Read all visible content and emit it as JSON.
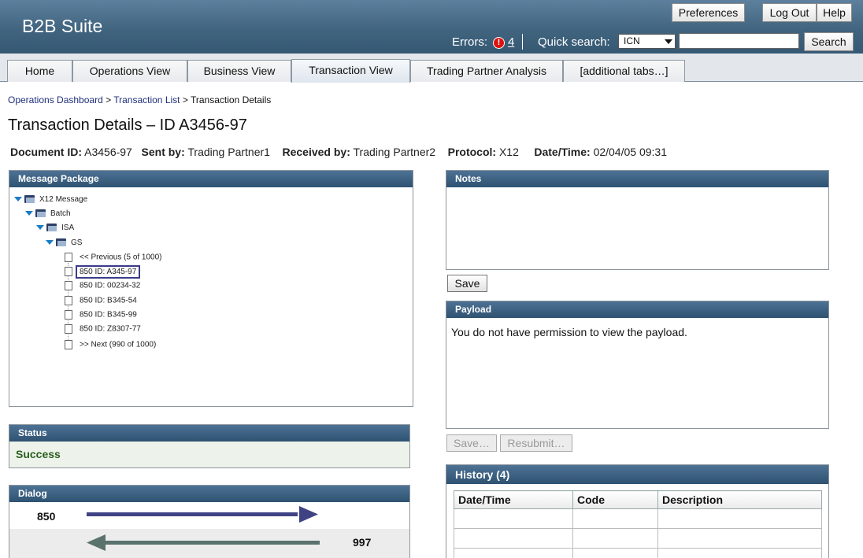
{
  "header": {
    "title": "B2B Suite",
    "preferences_label": "Preferences",
    "logout_label": "Log Out",
    "help_label": "Help",
    "errors_label": "Errors:",
    "errors_badge": "!",
    "errors_count": "4",
    "quick_search_label": "Quick search:",
    "quick_search_type": "ICN",
    "quick_search_value": "",
    "search_label": "Search"
  },
  "tabs": [
    {
      "label": "Home"
    },
    {
      "label": "Operations View"
    },
    {
      "label": "Business View"
    },
    {
      "label": "Transaction View",
      "active": true
    },
    {
      "label": "Trading Partner Analysis"
    },
    {
      "label": "[additional tabs…]"
    }
  ],
  "breadcrumb": {
    "items": [
      "Operations Dashboard",
      "Transaction List"
    ],
    "separator": ">",
    "current": "Transaction Details"
  },
  "page": {
    "title": "Transaction Details – ID A3456-97"
  },
  "meta": {
    "document_id_label": "Document ID:",
    "document_id": "A3456-97",
    "sent_by_label": "Sent by:",
    "sent_by": "Trading Partner1",
    "received_by_label": "Received by:",
    "received_by": "Trading Partner2",
    "protocol_label": "Protocol:",
    "protocol": "X12",
    "datetime_label": "Date/Time:",
    "datetime": "02/04/05 09:31"
  },
  "message_package": {
    "title": "Message Package",
    "tree": {
      "root": "X12 Message",
      "batch": "Batch",
      "isa": "ISA",
      "gs": "GS",
      "prev": "<< Previous (5 of 1000)",
      "items": [
        "850 ID: A345-97",
        "850 ID: 00234-32",
        "850 ID: B345-54",
        "850 ID: B345-99",
        "850 ID: Z8307-77"
      ],
      "next": ">> Next (990 of 1000)"
    }
  },
  "status": {
    "title": "Status",
    "value": "Success"
  },
  "dialog": {
    "title": "Dialog",
    "outgoing_label": "850",
    "incoming_label": "997",
    "colors": {
      "outgoing": "#3f4283",
      "incoming": "#5a736c"
    }
  },
  "notes": {
    "title": "Notes",
    "value": "",
    "save_label": "Save"
  },
  "payload": {
    "title": "Payload",
    "message": "You do not have permission to view the payload.",
    "save_label": "Save…",
    "resubmit_label": "Resubmit…"
  },
  "history": {
    "title": "History (4)",
    "columns": [
      "Date/Time",
      "Code",
      "Description"
    ]
  }
}
